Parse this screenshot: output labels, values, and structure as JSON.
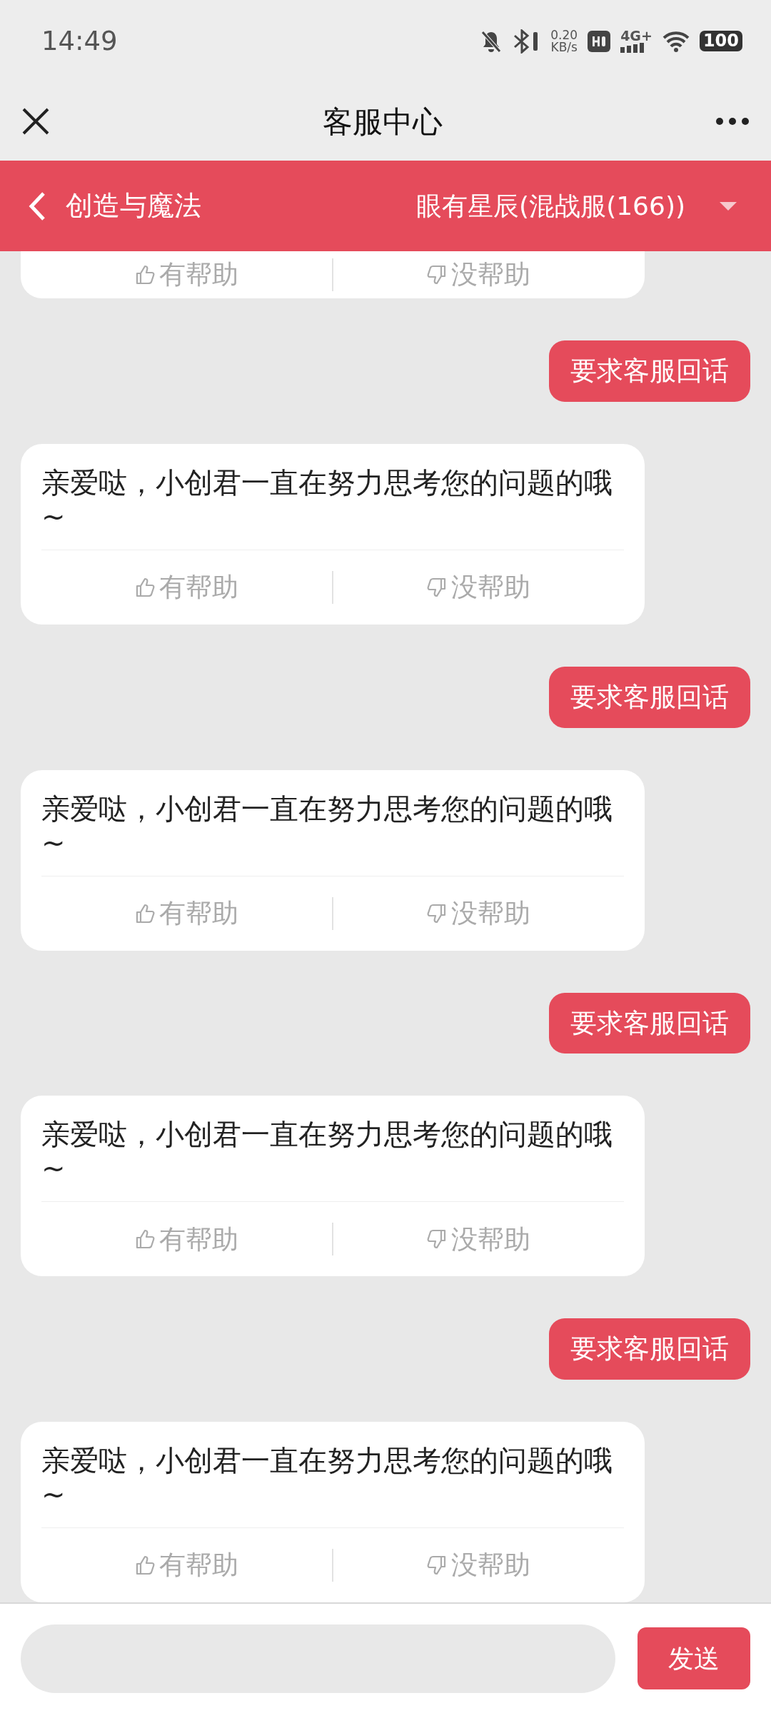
{
  "status_bar": {
    "time": "14:49",
    "speed_value": "0.20",
    "speed_unit": "KB/s",
    "network": "4G+",
    "battery": "100"
  },
  "nav": {
    "title": "客服中心"
  },
  "game_bar": {
    "game": "创造与魔法",
    "server": "眼有星辰(混战服(166))"
  },
  "messages": [
    {
      "kind": "bot_partial",
      "helpful": "有帮助",
      "unhelpful": "没帮助"
    },
    {
      "kind": "user",
      "text": "要求客服回话"
    },
    {
      "kind": "bot",
      "text": "亲爱哒，小创君一直在努力思考您的问题的哦~",
      "helpful": "有帮助",
      "unhelpful": "没帮助"
    },
    {
      "kind": "user",
      "text": "要求客服回话"
    },
    {
      "kind": "bot",
      "text": "亲爱哒，小创君一直在努力思考您的问题的哦~",
      "helpful": "有帮助",
      "unhelpful": "没帮助"
    },
    {
      "kind": "user",
      "text": "要求客服回话"
    },
    {
      "kind": "bot",
      "text": "亲爱哒，小创君一直在努力思考您的问题的哦~",
      "helpful": "有帮助",
      "unhelpful": "没帮助"
    },
    {
      "kind": "user",
      "text": "要求客服回话"
    },
    {
      "kind": "bot",
      "text": "亲爱哒，小创君一直在努力思考您的问题的哦~",
      "helpful": "有帮助",
      "unhelpful": "没帮助"
    }
  ],
  "composer": {
    "send": "发送"
  }
}
